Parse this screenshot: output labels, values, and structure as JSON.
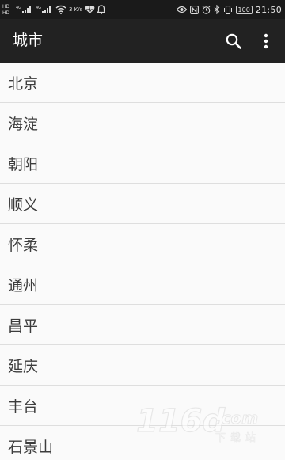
{
  "status_bar": {
    "left_indicators": [
      "4G",
      "4G",
      "3 K/s"
    ],
    "time": "21:50",
    "battery": "100"
  },
  "toolbar": {
    "title": "城市",
    "search_icon": "search-icon",
    "more_icon": "more-vertical-icon"
  },
  "cities": [
    "北京",
    "海淀",
    "朝阳",
    "顺义",
    "怀柔",
    "通州",
    "昌平",
    "延庆",
    "丰台",
    "石景山"
  ],
  "watermark": {
    "brand": "116d",
    "suffix": ".com",
    "sub": "下载站"
  },
  "colors": {
    "status_bar": "#1a1a1a",
    "toolbar": "#222222",
    "list_bg": "#fafafa",
    "divider": "#dedede",
    "text": "#3c3c3c"
  }
}
